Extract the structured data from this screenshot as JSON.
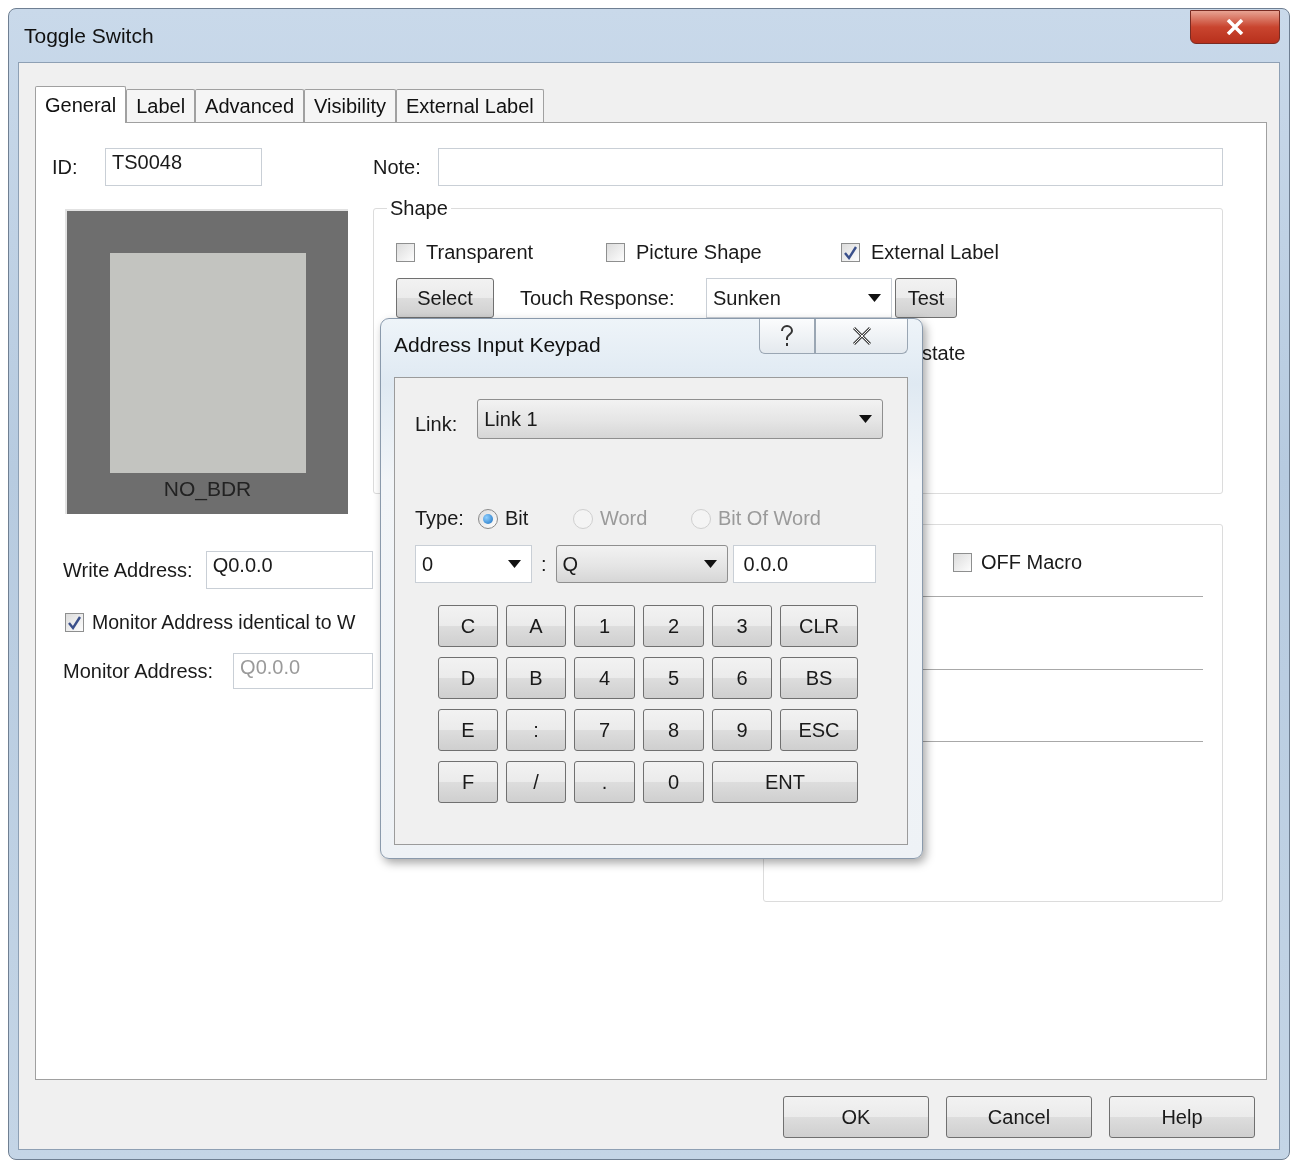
{
  "window": {
    "title": "Toggle Switch"
  },
  "tabs": [
    {
      "label": "General",
      "selected": true
    },
    {
      "label": "Label",
      "selected": false
    },
    {
      "label": "Advanced",
      "selected": false
    },
    {
      "label": "Visibility",
      "selected": false
    },
    {
      "label": "External Label",
      "selected": false
    }
  ],
  "id_field": {
    "label": "ID:",
    "value": "TS0048"
  },
  "note_field": {
    "label": "Note:"
  },
  "preview": {
    "caption": "NO_BDR"
  },
  "write_address": {
    "label": "Write Address:",
    "value": "Q0.0.0"
  },
  "monitor_identical": {
    "label": "Monitor Address identical to W",
    "checked": true
  },
  "monitor_address": {
    "label": "Monitor Address:",
    "value": "Q0.0.0",
    "disabled": true
  },
  "shape": {
    "title": "Shape",
    "options": [
      {
        "label": "Transparent",
        "checked": false
      },
      {
        "label": "Picture Shape",
        "checked": false
      },
      {
        "label": "External Label",
        "checked": true
      }
    ],
    "select_button": "Select",
    "touch_response": {
      "label": "Touch Response:",
      "value": "Sunken"
    },
    "test_button": "Test",
    "row_3_text": "state"
  },
  "macro": {
    "label": "OFF Macro",
    "checked": false
  },
  "buttons": [
    "OK",
    "Cancel",
    "Help"
  ],
  "keypad": {
    "title": "Address Input Keypad",
    "link": {
      "label": "Link:",
      "value": "Link 1"
    },
    "type": {
      "label": "Type:",
      "options": [
        {
          "label": "Bit",
          "selected": true,
          "disabled": false
        },
        {
          "label": "Word",
          "selected": false,
          "disabled": true
        },
        {
          "label": "Bit Of Word",
          "selected": false,
          "disabled": true
        }
      ]
    },
    "station": "0",
    "separator": ":",
    "device": "Q",
    "address": "0.0.0",
    "keys": [
      {
        "label": "C",
        "kind": "key"
      },
      {
        "label": "A",
        "kind": "key"
      },
      {
        "label": "1",
        "kind": "key"
      },
      {
        "label": "2",
        "kind": "key"
      },
      {
        "label": "3",
        "kind": "key"
      },
      {
        "label": "CLR",
        "kind": "key"
      },
      {
        "label": "D",
        "kind": "key"
      },
      {
        "label": "B",
        "kind": "key"
      },
      {
        "label": "4",
        "kind": "key"
      },
      {
        "label": "5",
        "kind": "key"
      },
      {
        "label": "6",
        "kind": "key"
      },
      {
        "label": "BS",
        "kind": "key"
      },
      {
        "label": "E",
        "kind": "key"
      },
      {
        "label": ":",
        "kind": "key"
      },
      {
        "label": "7",
        "kind": "key"
      },
      {
        "label": "8",
        "kind": "key"
      },
      {
        "label": "9",
        "kind": "key"
      },
      {
        "label": "ESC",
        "kind": "key"
      },
      {
        "label": "F",
        "kind": "key"
      },
      {
        "label": "/",
        "kind": "key"
      },
      {
        "label": ".",
        "kind": "key"
      },
      {
        "label": "0",
        "kind": "key"
      },
      {
        "label": "ENT",
        "kind": "wide"
      }
    ]
  }
}
